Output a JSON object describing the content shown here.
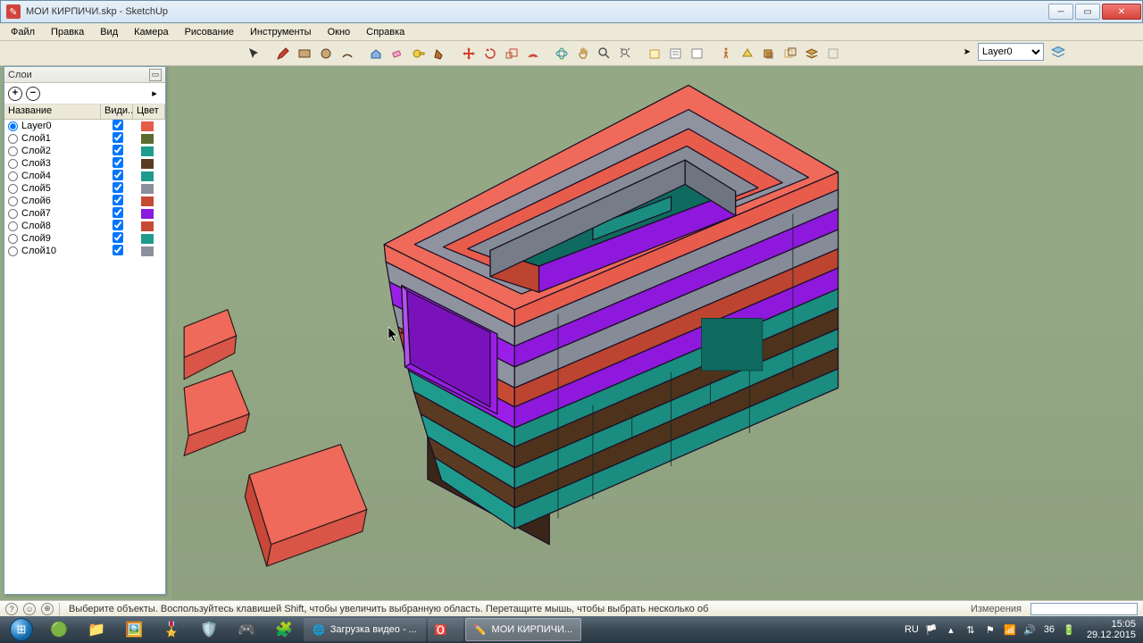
{
  "window": {
    "title": "МОИ КИРПИЧИ.skp - SketchUp"
  },
  "menu": {
    "items": [
      "Файл",
      "Правка",
      "Вид",
      "Камера",
      "Рисование",
      "Инструменты",
      "Окно",
      "Справка"
    ]
  },
  "layerDropdown": {
    "value": "Layer0"
  },
  "layersPanel": {
    "title": "Слои",
    "headers": {
      "name": "Название",
      "visible": "Види...",
      "color": "Цвет"
    },
    "rows": [
      {
        "name": "Layer0",
        "active": true,
        "visible": true,
        "color": "#e65a48"
      },
      {
        "name": "Слой1",
        "active": false,
        "visible": true,
        "color": "#5a6b2e"
      },
      {
        "name": "Слой2",
        "active": false,
        "visible": true,
        "color": "#1f9b8e"
      },
      {
        "name": "Слой3",
        "active": false,
        "visible": true,
        "color": "#5a3b22"
      },
      {
        "name": "Слой4",
        "active": false,
        "visible": true,
        "color": "#1f9b8e"
      },
      {
        "name": "Слой5",
        "active": false,
        "visible": true,
        "color": "#8a8f9b"
      },
      {
        "name": "Слой6",
        "active": false,
        "visible": true,
        "color": "#c74a34"
      },
      {
        "name": "Слой7",
        "active": false,
        "visible": true,
        "color": "#8a1ae0"
      },
      {
        "name": "Слой8",
        "active": false,
        "visible": true,
        "color": "#c74a34"
      },
      {
        "name": "Слой9",
        "active": false,
        "visible": true,
        "color": "#1f9b8e"
      },
      {
        "name": "Слой10",
        "active": false,
        "visible": true,
        "color": "#8a8f9b"
      }
    ]
  },
  "statusbar": {
    "hint": "Выберите объекты. Воспользуйтесь клавишей Shift, чтобы увеличить выбранную область. Перетащите мышь, чтобы выбрать несколько об",
    "measureLabel": "Измерения"
  },
  "taskbar": {
    "tasks": [
      {
        "icon": "chrome",
        "label": "Загрузка видео - ...",
        "active": false
      },
      {
        "icon": "opera",
        "label": "",
        "active": false
      },
      {
        "icon": "sketchup",
        "label": "МОИ КИРПИЧИ...",
        "active": true
      }
    ],
    "tray": {
      "lang": "RU",
      "net": "access-icon",
      "vol": "36",
      "time": "15:05",
      "date": "29.12.2015"
    }
  },
  "icons": {
    "tools": [
      "select",
      "pencil",
      "line",
      "rect",
      "circle",
      "arc",
      "pushpull",
      "eraser",
      "tape",
      "protractor",
      "move",
      "rotate",
      "scale",
      "offset",
      "orbit",
      "pan",
      "zoom",
      "zoom-extents",
      "3dtext",
      "section",
      "walk",
      "lookaround",
      "paint",
      "component",
      "outliner",
      "shadows"
    ]
  }
}
